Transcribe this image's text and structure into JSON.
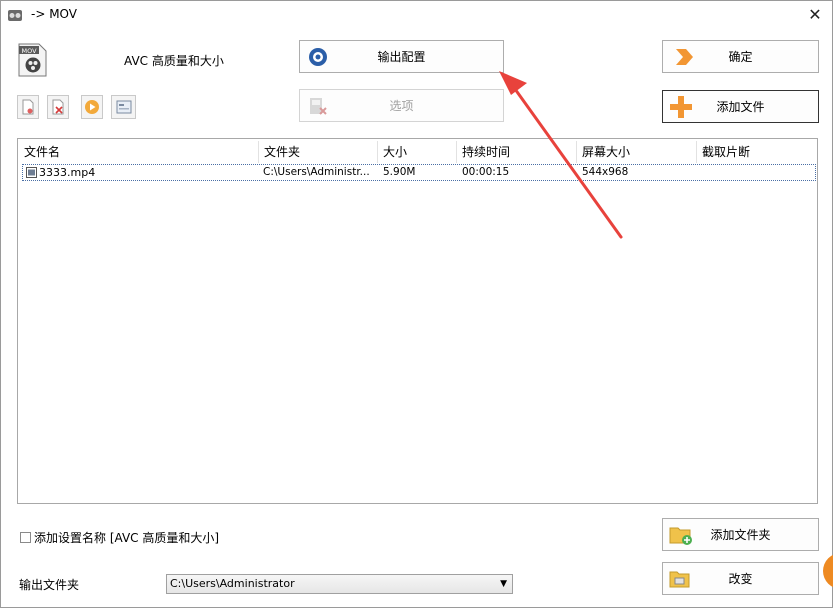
{
  "window": {
    "title": "-> MOV"
  },
  "profile": {
    "name": "AVC 高质量和大小",
    "format_badge": "MOV"
  },
  "buttons": {
    "output_config": "输出配置",
    "confirm": "确定",
    "options": "选项",
    "add_file": "添加文件",
    "add_folder": "添加文件夹",
    "change": "改变"
  },
  "list": {
    "columns": [
      "文件名",
      "文件夹",
      "大小",
      "持续时间",
      "屏幕大小",
      "截取片断"
    ],
    "rows": [
      {
        "name": "3333.mp4",
        "folder": "C:\\Users\\Administr...",
        "size": "5.90M",
        "duration": "00:00:15",
        "screen": "544x968",
        "clip": ""
      }
    ]
  },
  "add_setting_name": {
    "label": "添加设置名称 [AVC 高质量和大小]",
    "checked": false
  },
  "output": {
    "label": "输出文件夹",
    "value": "C:\\Users\\Administrator"
  },
  "annotation": {
    "arrow_color": "#e8423c"
  }
}
